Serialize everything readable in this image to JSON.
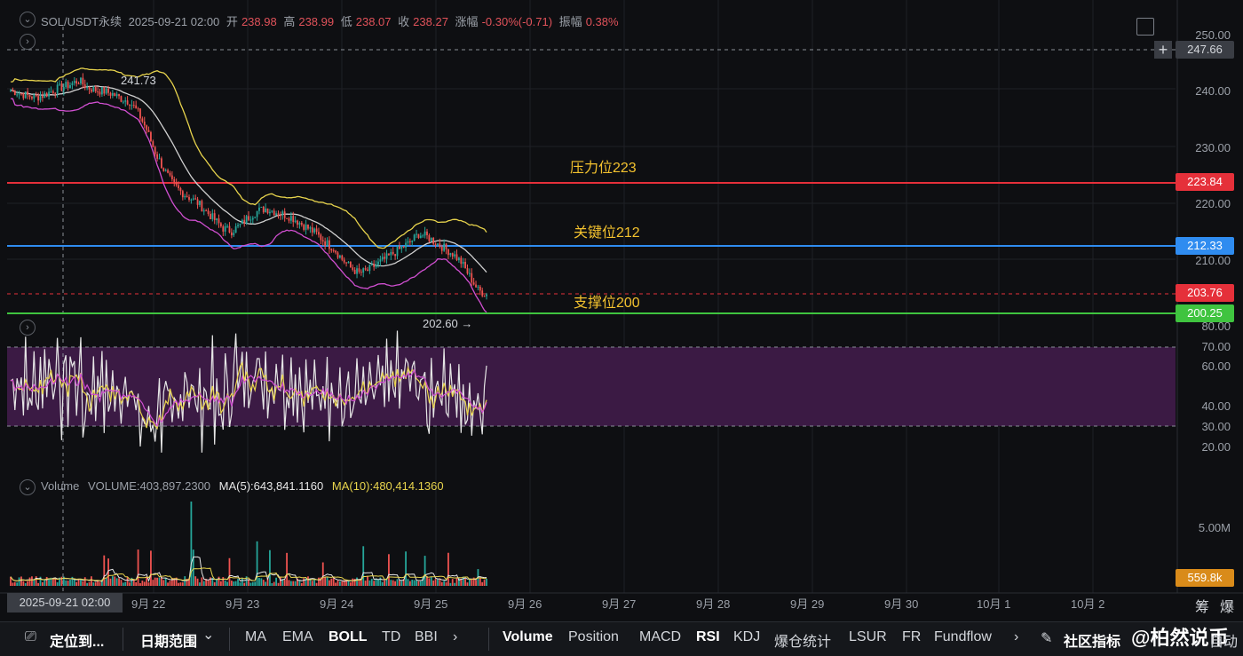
{
  "header": {
    "symbol": "SOL/USDT永续",
    "datetime": "2025-09-21 02:00",
    "open_label": "开",
    "open": "238.98",
    "high_label": "高",
    "high": "238.99",
    "low_label": "低",
    "low": "238.07",
    "close_label": "收",
    "close": "238.27",
    "change_label": "涨幅",
    "change": "-0.30%(-0.71)",
    "amplitude_label": "振幅",
    "amplitude": "0.38%"
  },
  "price_axis": [
    "250.00",
    "240.00",
    "230.00",
    "220.00",
    "210.00"
  ],
  "price_tags": {
    "crosshair": "247.66",
    "resistance": "223.84",
    "key": "212.33",
    "current": "203.76",
    "support": "200.25"
  },
  "annotations": {
    "resistance": "压力位223",
    "key": "关键位212",
    "support": "支撑位200",
    "high_mark": "241.73",
    "low_mark": "202.60 →"
  },
  "rsi_axis": [
    "80.00",
    "70.00",
    "60.00",
    "40.00",
    "30.00",
    "20.00"
  ],
  "volume": {
    "label": "Volume",
    "value": "VOLUME:403,897.2300",
    "ma5": "MA(5):643,841.1160",
    "ma10": "MA(10):480,414.1360",
    "axis_top": "5.00M",
    "tag": "559.8k"
  },
  "time_axis": {
    "cursor": "2025-09-21 02:00",
    "labels": [
      "9月 22",
      "9月 23",
      "9月 24",
      "9月 25",
      "9月 26",
      "9月 27",
      "9月 28",
      "9月 29",
      "9月 30",
      "10月 1",
      "10月 2"
    ],
    "right_a": "筹",
    "right_b": "爆"
  },
  "toolbar": {
    "locate": "定位到...",
    "date_range": "日期范围",
    "chevron_down": "⌄",
    "indicators_main": [
      "MA",
      "EMA",
      "BOLL",
      "TD",
      "BBI"
    ],
    "indicators_sub": [
      "Volume",
      "Position",
      "MACD",
      "RSI",
      "KDJ",
      "爆仓统计",
      "LSUR",
      "FR",
      "Fundflow"
    ],
    "more": "›",
    "community": "社区指标",
    "watermark": "@柏然说币",
    "auto": "自动"
  },
  "colors": {
    "up": "#26a69a",
    "down": "#ef5350",
    "boll_upper": "#e8d44d",
    "boll_mid": "#d0d0d0",
    "boll_lower": "#d14fd1",
    "resistance": "#e5303a",
    "key": "#2f8cf0",
    "support": "#3fc43f",
    "rsi_band": "#3b1a44",
    "accent": "#f2c12e"
  },
  "chart_data": {
    "type": "candlestick",
    "candles_approx": [
      240,
      239.5,
      239,
      238.7,
      239.2,
      240,
      240.5,
      241,
      241.7,
      240.5,
      240,
      239.8,
      239.3,
      238.5,
      238,
      236,
      233,
      229,
      226,
      223.5,
      222,
      221,
      220,
      218.5,
      217,
      215.5,
      215,
      216,
      217.5,
      218.5,
      219,
      218.5,
      218,
      217.5,
      216.5,
      215.5,
      214.5,
      213,
      212,
      210,
      208.5,
      207.5,
      208,
      209,
      210,
      211,
      212,
      213,
      214.5,
      214,
      213,
      212,
      211,
      209.5,
      207,
      204.5,
      203.8
    ],
    "levels": {
      "resistance": 223.84,
      "key": 212.33,
      "support": 200.25,
      "current": 203.76
    },
    "high": 241.73,
    "low": 202.6
  }
}
